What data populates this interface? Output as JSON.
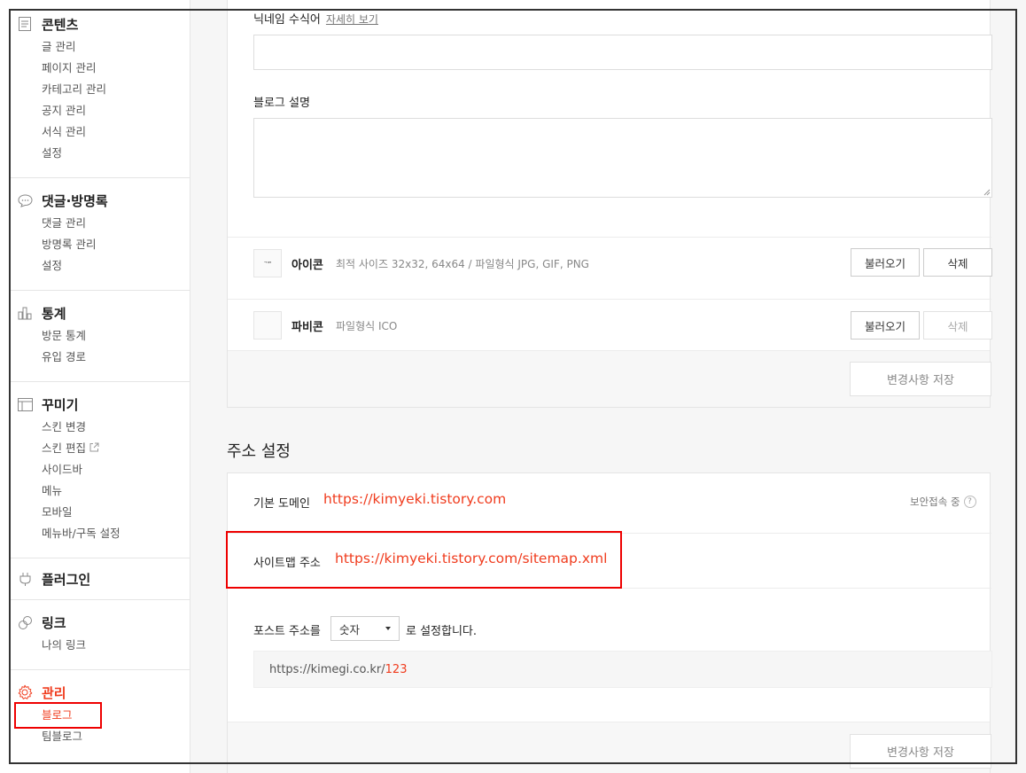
{
  "sidebar": {
    "groups": [
      {
        "title": "콘텐츠",
        "icon": "document-icon",
        "items": [
          "글 관리",
          "페이지 관리",
          "카테고리 관리",
          "공지 관리",
          "서식 관리",
          "설정"
        ]
      },
      {
        "title": "댓글·방명록",
        "icon": "speech-bubble-icon",
        "items": [
          "댓글 관리",
          "방명록 관리",
          "설정"
        ]
      },
      {
        "title": "통계",
        "icon": "bar-chart-icon",
        "items": [
          "방문 통계",
          "유입 경로"
        ]
      },
      {
        "title": "꾸미기",
        "icon": "layout-icon",
        "items": [
          "스킨 변경",
          "스킨 편집",
          "사이드바",
          "메뉴",
          "모바일",
          "메뉴바/구독 설정"
        ]
      },
      {
        "title": "플러그인",
        "icon": "plug-icon",
        "items": []
      },
      {
        "title": "링크",
        "icon": "link-icon",
        "items": [
          "나의 링크"
        ]
      },
      {
        "title": "관리",
        "icon": "gear-icon",
        "items": [
          "블로그",
          "팀블로그"
        ]
      }
    ]
  },
  "blog_info": {
    "nickname_label": "닉네임 수식어",
    "nickname_more": "자세히 보기",
    "nickname_value": "",
    "desc_label": "블로그 설명",
    "desc_value": "",
    "icon_label": "아이콘",
    "icon_thumb_text": "ᄀᄆᄀ",
    "icon_desc": "최적 사이즈 32x32, 64x64 / 파일형식 JPG, GIF, PNG",
    "favicon_label": "파비콘",
    "favicon_desc": "파일형식 ICO",
    "load_button": "불러오기",
    "delete_button": "삭제",
    "save_button": "변경사항 저장"
  },
  "address": {
    "section_title": "주소 설정",
    "domain_label": "기본 도메인",
    "domain_value": "https://kimyeki.tistory.com",
    "secure_text": "보안접속 중",
    "secure_help": "?",
    "sitemap_label": "사이트맵 주소",
    "sitemap_value": "https://kimyeki.tistory.com/sitemap.xml",
    "post_prefix": "포스트 주소를",
    "post_select": "숫자",
    "post_suffix": "로 설정합니다.",
    "example_base": "https://kimegi.co.kr/",
    "example_id": "123",
    "save_button": "변경사항 저장"
  },
  "colors": {
    "accent": "#f03c1e",
    "highlight_box": "#ee0000"
  }
}
